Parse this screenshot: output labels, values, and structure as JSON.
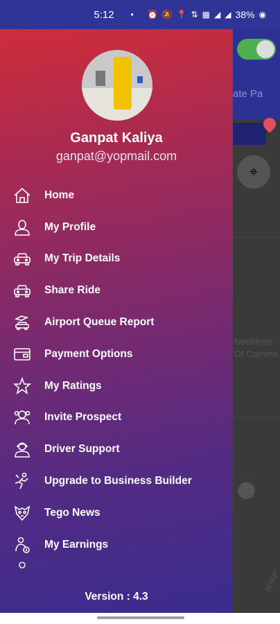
{
  "status_bar": {
    "time": "5:12",
    "dot": "•",
    "icons": [
      "alarm-icon",
      "mute-icon",
      "location-icon",
      "data-icon",
      "volte-icon",
      "signal-icon"
    ],
    "battery_text": "38%"
  },
  "background_app": {
    "tab_text": "ate Pa",
    "map_text": "Neeldeep\nOf Comme",
    "map_text_small": "Bridge"
  },
  "drawer": {
    "user_name": "Ganpat Kaliya",
    "user_email": "ganpat@yopmail.com",
    "menu_items": [
      {
        "label": "Home",
        "icon": "home-icon"
      },
      {
        "label": "My Profile",
        "icon": "profile-icon"
      },
      {
        "label": "My Trip Details",
        "icon": "car-icon"
      },
      {
        "label": "Share Ride",
        "icon": "car-icon"
      },
      {
        "label": "Airport Queue Report",
        "icon": "airport-icon"
      },
      {
        "label": "Payment Options",
        "icon": "card-icon"
      },
      {
        "label": "My Ratings",
        "icon": "star-icon"
      },
      {
        "label": "Invite Prospect",
        "icon": "invite-icon"
      },
      {
        "label": "Driver Support",
        "icon": "support-icon"
      },
      {
        "label": "Upgrade to Business Builder",
        "icon": "upgrade-icon"
      },
      {
        "label": "Tego News",
        "icon": "news-icon"
      },
      {
        "label": "My Earnings",
        "icon": "earnings-icon"
      }
    ],
    "version": "Version : 4.3"
  }
}
